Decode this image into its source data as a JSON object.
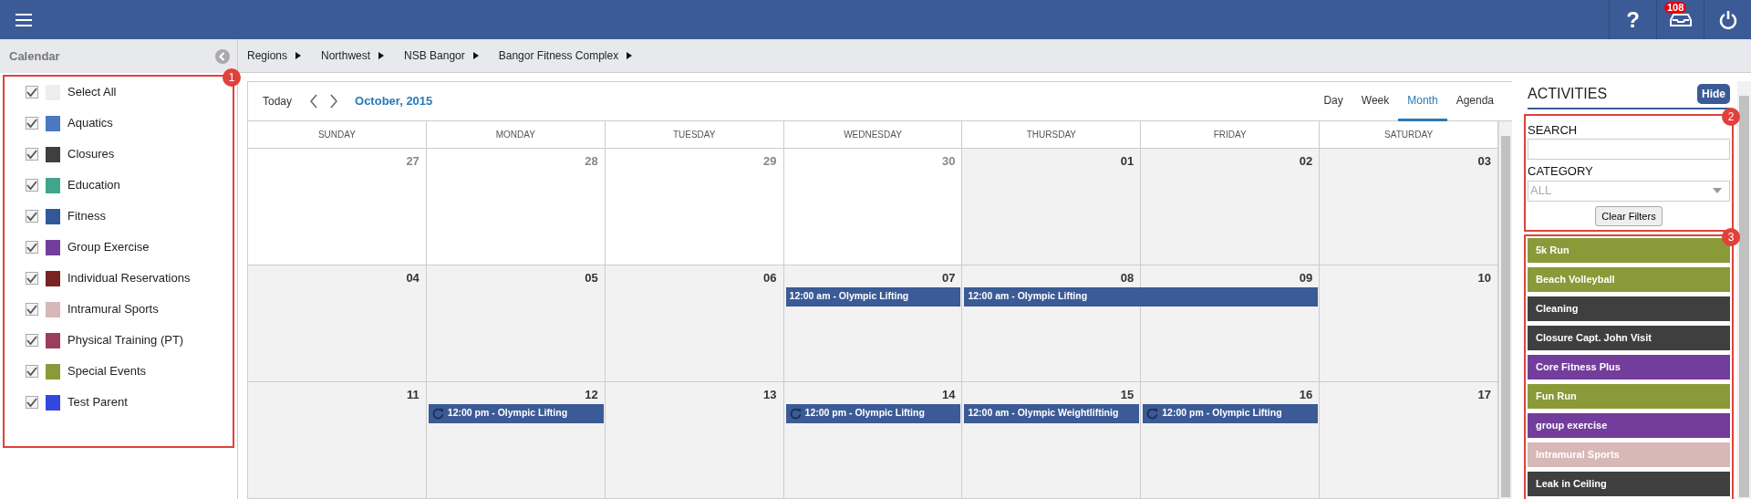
{
  "topbar": {
    "help_label": "?",
    "notification_count": "108"
  },
  "sidebar": {
    "title": "Calendar",
    "callout": "1",
    "items": [
      {
        "label": "Select All",
        "color": "#eeeeee",
        "checked": true
      },
      {
        "label": "Aquatics",
        "color": "#4a78c2",
        "checked": true
      },
      {
        "label": "Closures",
        "color": "#3f3f3f",
        "checked": true
      },
      {
        "label": "Education",
        "color": "#3fa58c",
        "checked": true
      },
      {
        "label": "Fitness",
        "color": "#33589a",
        "checked": true
      },
      {
        "label": "Group Exercise",
        "color": "#733d9b",
        "checked": true
      },
      {
        "label": "Individual Reservations",
        "color": "#7a2222",
        "checked": true
      },
      {
        "label": "Intramural Sports",
        "color": "#d8b7b7",
        "checked": true
      },
      {
        "label": "Physical Training (PT)",
        "color": "#9a3d5e",
        "checked": true
      },
      {
        "label": "Special Events",
        "color": "#8a9a38",
        "checked": true
      },
      {
        "label": "Test Parent",
        "color": "#3347e0",
        "checked": true
      }
    ]
  },
  "breadcrumb": [
    "Regions",
    "Northwest",
    "NSB Bangor",
    "Bangor Fitness Complex"
  ],
  "calendar": {
    "today_label": "Today",
    "title": "October, 2015",
    "views": [
      {
        "label": "Day",
        "selected": false
      },
      {
        "label": "Week",
        "selected": false
      },
      {
        "label": "Month",
        "selected": true
      },
      {
        "label": "Agenda",
        "selected": false
      }
    ],
    "weekdays": [
      "SUNDAY",
      "MONDAY",
      "TUESDAY",
      "WEDNESDAY",
      "THURSDAY",
      "FRIDAY",
      "SATURDAY"
    ],
    "weeks": [
      {
        "days": [
          {
            "number": "27",
            "other_month": true
          },
          {
            "number": "28",
            "other_month": true
          },
          {
            "number": "29",
            "other_month": true
          },
          {
            "number": "30",
            "other_month": true
          },
          {
            "number": "01",
            "other_month": false
          },
          {
            "number": "02",
            "other_month": false
          },
          {
            "number": "03",
            "other_month": false
          }
        ]
      },
      {
        "days": [
          {
            "number": "04",
            "other_month": false
          },
          {
            "number": "05",
            "other_month": false
          },
          {
            "number": "06",
            "other_month": false
          },
          {
            "number": "07",
            "other_month": false,
            "events": [
              {
                "text": "12:00 am - Olympic Lifting",
                "recurring": false,
                "continues_next_day": false
              }
            ]
          },
          {
            "number": "08",
            "other_month": false,
            "events": [
              {
                "text": "12:00 am - Olympic Lifting",
                "recurring": false,
                "continues_next_day": true
              }
            ]
          },
          {
            "number": "09",
            "other_month": false
          },
          {
            "number": "10",
            "other_month": false
          }
        ]
      },
      {
        "days": [
          {
            "number": "11",
            "other_month": false
          },
          {
            "number": "12",
            "other_month": false,
            "events": [
              {
                "text": "12:00 pm - Olympic Lifting",
                "recurring": true,
                "continues_next_day": false
              }
            ]
          },
          {
            "number": "13",
            "other_month": false
          },
          {
            "number": "14",
            "other_month": false,
            "events": [
              {
                "text": "12:00 pm - Olympic Lifting",
                "recurring": true,
                "continues_next_day": false
              }
            ]
          },
          {
            "number": "15",
            "other_month": false,
            "events": [
              {
                "text": "12:00 am - Olympic Weightliftinig",
                "recurring": false,
                "continues_next_day": false
              }
            ]
          },
          {
            "number": "16",
            "other_month": false,
            "events": [
              {
                "text": "12:00 pm - Olympic Lifting",
                "recurring": true,
                "continues_next_day": false
              }
            ]
          },
          {
            "number": "17",
            "other_month": false
          }
        ]
      }
    ]
  },
  "activities": {
    "title": "ACTIVITIES",
    "hide_label": "Hide",
    "filter_callout": "2",
    "search_label": "SEARCH",
    "category_label": "CATEGORY",
    "category_value": "ALL",
    "clear_label": "Clear Filters",
    "list_callout": "3",
    "items": [
      {
        "label": "5k Run",
        "color": "#8a9a38"
      },
      {
        "label": "Beach Volleyball",
        "color": "#8a9a38"
      },
      {
        "label": "Cleaning",
        "color": "#3f3f3f"
      },
      {
        "label": "Closure Capt. John Visit",
        "color": "#3f3f3f"
      },
      {
        "label": "Core Fitness Plus",
        "color": "#733d9b"
      },
      {
        "label": "Fun Run",
        "color": "#8a9a38"
      },
      {
        "label": "group exercise",
        "color": "#733d9b"
      },
      {
        "label": "Intramural Sports",
        "color": "#d8b7b7"
      },
      {
        "label": "Leak in Ceiling",
        "color": "#3f3f3f"
      }
    ]
  }
}
